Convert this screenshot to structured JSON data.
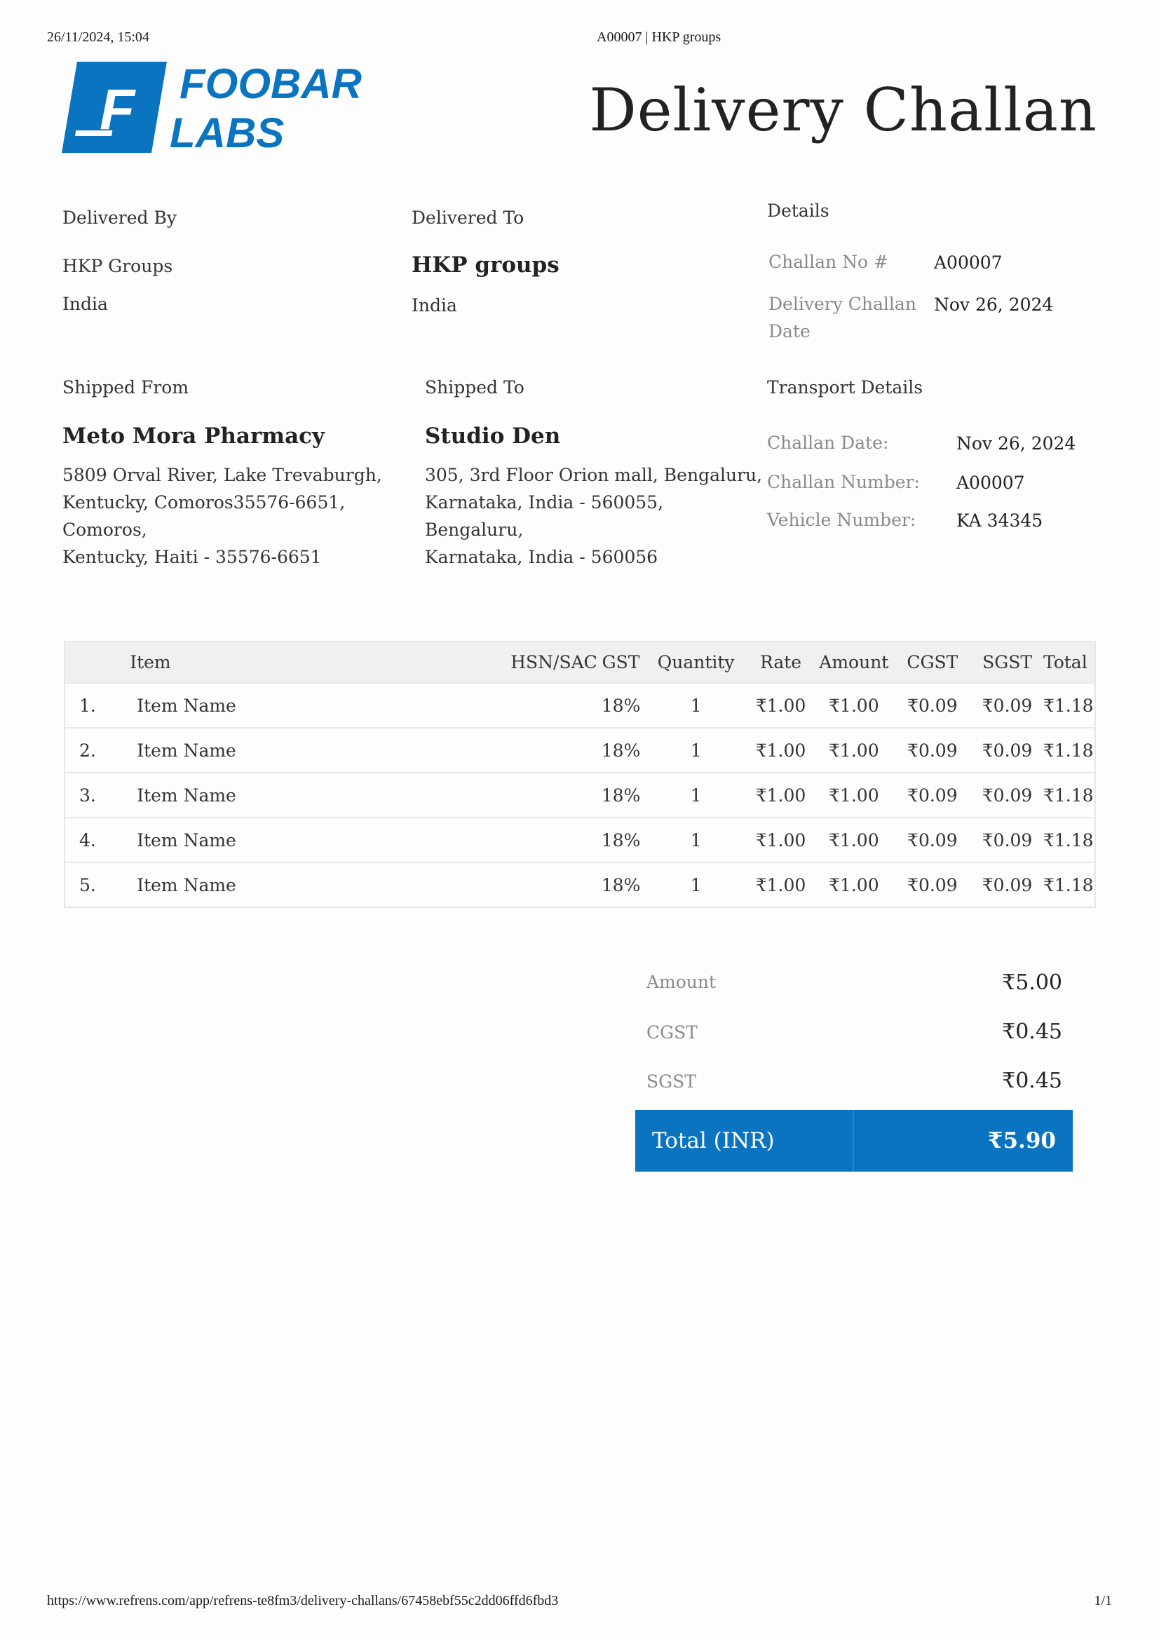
{
  "print_header": {
    "datetime": "26/11/2024, 15:04",
    "title": "A00007 | HKP groups"
  },
  "print_footer": {
    "url": "https://www.refrens.com/app/refrens-te8fm3/delivery-challans/67458ebf55c2dd06ffd6fbd3",
    "page": "1/1"
  },
  "logo": {
    "line1": "FOOBAR",
    "line2": "LABS",
    "mark": "F",
    "color": "#0b74c1"
  },
  "document_title": "Delivery Challan",
  "delivered_by": {
    "label": "Delivered By",
    "name": "HKP Groups",
    "country": "India"
  },
  "delivered_to": {
    "label": "Delivered To",
    "name": "HKP groups",
    "country": "India"
  },
  "details": {
    "label": "Details",
    "challan_no_label": "Challan No #",
    "challan_no": "A00007",
    "date_label_1": "Delivery Challan",
    "date_label_2": "Date",
    "date": "Nov 26, 2024"
  },
  "shipped_from": {
    "label": "Shipped From",
    "name": "Meto Mora Pharmacy",
    "lines": [
      "5809 Orval River, Lake Trevaburgh,",
      "Kentucky, Comoros35576-6651,",
      "Comoros,",
      "Kentucky, Haiti - 35576-6651"
    ]
  },
  "shipped_to": {
    "label": "Shipped To",
    "name": "Studio Den",
    "lines": [
      "305, 3rd Floor Orion mall, Bengaluru,",
      "Karnataka, India - 560055,",
      "Bengaluru,",
      "Karnataka, India - 560056"
    ]
  },
  "transport": {
    "label": "Transport Details",
    "rows": [
      {
        "label": "Challan Date:",
        "value": "Nov 26, 2024"
      },
      {
        "label": "Challan Number:",
        "value": "A00007"
      },
      {
        "label": "Vehicle Number:",
        "value": "KA 34345"
      }
    ]
  },
  "table": {
    "headers": {
      "item": "Item",
      "hsn": "HSN/SAC",
      "gst": "GST",
      "qty": "Quantity",
      "rate": "Rate",
      "amount": "Amount",
      "cgst": "CGST",
      "sgst": "SGST",
      "total": "Total"
    },
    "rows": [
      {
        "num": "1.",
        "item": "Item Name",
        "hsn": "",
        "gst": "18%",
        "qty": "1",
        "rate": "₹1.00",
        "amount": "₹1.00",
        "cgst": "₹0.09",
        "sgst": "₹0.09",
        "total": "₹1.18"
      },
      {
        "num": "2.",
        "item": "Item Name",
        "hsn": "",
        "gst": "18%",
        "qty": "1",
        "rate": "₹1.00",
        "amount": "₹1.00",
        "cgst": "₹0.09",
        "sgst": "₹0.09",
        "total": "₹1.18"
      },
      {
        "num": "3.",
        "item": "Item Name",
        "hsn": "",
        "gst": "18%",
        "qty": "1",
        "rate": "₹1.00",
        "amount": "₹1.00",
        "cgst": "₹0.09",
        "sgst": "₹0.09",
        "total": "₹1.18"
      },
      {
        "num": "4.",
        "item": "Item Name",
        "hsn": "",
        "gst": "18%",
        "qty": "1",
        "rate": "₹1.00",
        "amount": "₹1.00",
        "cgst": "₹0.09",
        "sgst": "₹0.09",
        "total": "₹1.18"
      },
      {
        "num": "5.",
        "item": "Item Name",
        "hsn": "",
        "gst": "18%",
        "qty": "1",
        "rate": "₹1.00",
        "amount": "₹1.00",
        "cgst": "₹0.09",
        "sgst": "₹0.09",
        "total": "₹1.18"
      }
    ]
  },
  "totals": {
    "amount_label": "Amount",
    "amount": "₹5.00",
    "cgst_label": "CGST",
    "cgst": "₹0.45",
    "sgst_label": "SGST",
    "sgst": "₹0.45",
    "total_label": "Total (INR)",
    "total": "₹5.90"
  }
}
